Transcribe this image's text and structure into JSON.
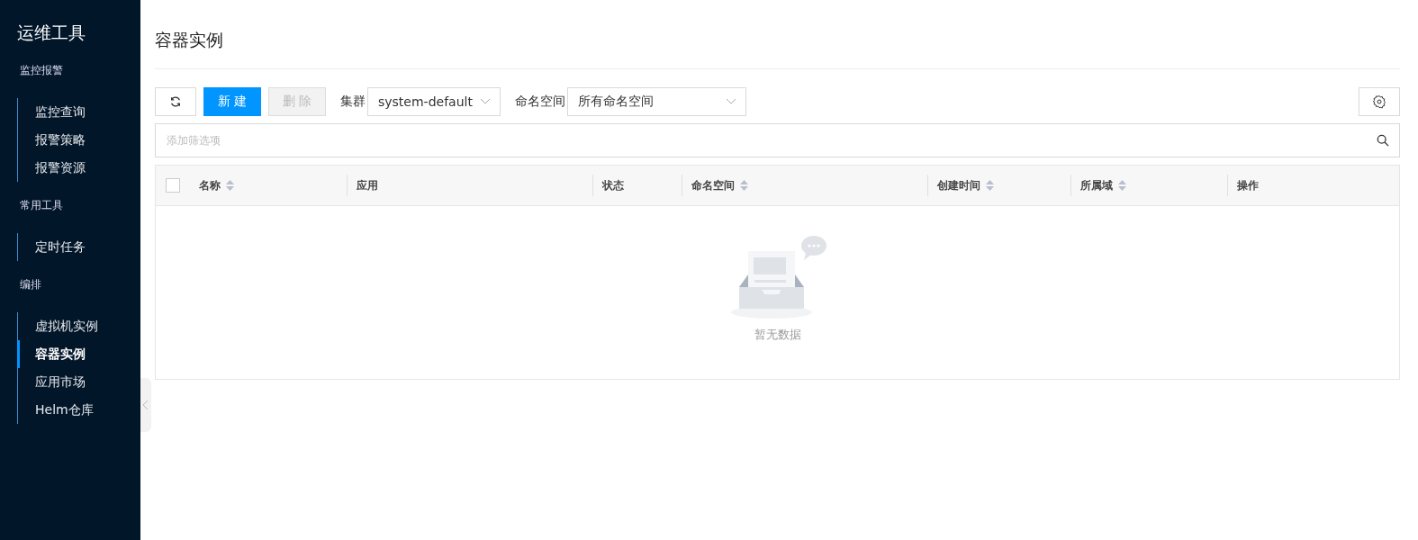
{
  "sidebar": {
    "title": "运维工具",
    "groups": [
      {
        "label": "监控报警",
        "items": [
          {
            "label": "监控查询",
            "selected": false
          },
          {
            "label": "报警策略",
            "selected": false
          },
          {
            "label": "报警资源",
            "selected": false
          }
        ]
      },
      {
        "label": "常用工具",
        "items": [
          {
            "label": "定时任务",
            "selected": false
          }
        ]
      },
      {
        "label": "编排",
        "items": [
          {
            "label": "虚拟机实例",
            "selected": false
          },
          {
            "label": "容器实例",
            "selected": true
          },
          {
            "label": "应用市场",
            "selected": false
          },
          {
            "label": "Helm仓库",
            "selected": false
          }
        ]
      }
    ]
  },
  "page_title": "容器实例",
  "toolbar": {
    "buttons": [
      {
        "kind": "refresh"
      },
      {
        "kind": "primary",
        "label": "新 建"
      },
      {
        "kind": "default",
        "label": "删 除",
        "disabled": true
      }
    ],
    "filters": [
      {
        "label": "集群",
        "value": "system-default"
      },
      {
        "label": "命名空间",
        "value": "所有命名空间"
      }
    ]
  },
  "search": {
    "placeholder": "添加筛选项"
  },
  "table": {
    "checked": false,
    "columns": [
      {
        "label": "名称",
        "sortable": true
      },
      {
        "label": "应用",
        "sortable": false
      },
      {
        "label": "状态",
        "sortable": false
      },
      {
        "label": "命名空间",
        "sortable": true
      },
      {
        "label": "创建时间",
        "sortable": true
      },
      {
        "label": "所属域",
        "sortable": true
      },
      {
        "label": "操作",
        "sortable": false
      }
    ],
    "empty_text": "暂无数据"
  }
}
